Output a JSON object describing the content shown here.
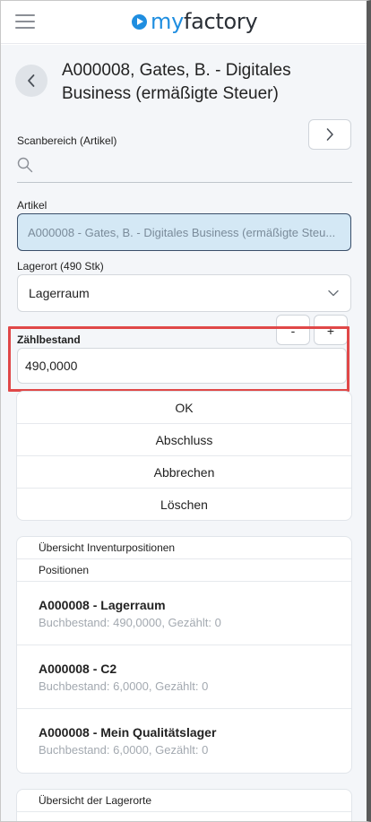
{
  "header": {
    "logo_prefix": "my",
    "logo_suffix": "factory"
  },
  "page": {
    "title": "A000008, Gates, B. - Digitales Business (ermäßigte Steuer)"
  },
  "scan": {
    "label": "Scanbereich (Artikel)",
    "placeholder": ""
  },
  "article": {
    "label": "Artikel",
    "value": "A000008 - Gates, B. - Digitales Business (ermäßigte Steu..."
  },
  "lagerort": {
    "label": "Lagerort (490 Stk)",
    "value": "Lagerraum"
  },
  "stepper": {
    "minus": "-",
    "plus": "+"
  },
  "zaehlbestand": {
    "label": "Zählbestand",
    "value": "490,0000"
  },
  "actions": [
    "OK",
    "Abschluss",
    "Abbrechen",
    "Löschen"
  ],
  "overview": {
    "title": "Übersicht Inventurpositionen",
    "subtitle": "Positionen",
    "positions": [
      {
        "title": "A000008 - Lagerraum",
        "detail": "Buchbestand: 490,0000, Gezählt: 0"
      },
      {
        "title": "A000008 - C2",
        "detail": "Buchbestand: 6,0000, Gezählt: 0"
      },
      {
        "title": "A000008 - Mein Qualitätslager",
        "detail": "Buchbestand: 6,0000, Gezählt: 0"
      }
    ]
  },
  "lagerorte": {
    "title": "Übersicht der Lagerorte"
  },
  "icons": {
    "menu": "hamburger-icon",
    "back": "chevron-left-icon",
    "next": "chevron-right-icon",
    "search": "search-icon",
    "dropdown": "chevron-down-icon"
  },
  "colors": {
    "brand": "#1f8ee0",
    "highlight": "#e04848",
    "article_bg": "#d4e8f5"
  }
}
